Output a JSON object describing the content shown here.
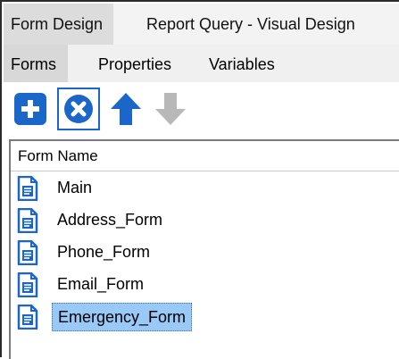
{
  "main_tabs": [
    {
      "label": "Form Design",
      "active": true
    },
    {
      "label": "Report Query - Visual Design",
      "active": false
    }
  ],
  "sub_tabs": [
    {
      "label": "Forms",
      "active": true
    },
    {
      "label": "Properties",
      "active": false
    },
    {
      "label": "Variables",
      "active": false
    }
  ],
  "toolbar": {
    "add_icon": "plus-icon",
    "remove_icon": "remove-circle-icon",
    "move_up_icon": "arrow-up-icon",
    "move_down_icon": "arrow-down-icon",
    "move_down_enabled": false
  },
  "list": {
    "header": "Form Name",
    "items": [
      {
        "label": "Main",
        "selected": false
      },
      {
        "label": "Address_Form",
        "selected": false
      },
      {
        "label": "Phone_Form",
        "selected": false
      },
      {
        "label": "Email_Form",
        "selected": false
      },
      {
        "label": "Emergency_Form",
        "selected": true
      }
    ]
  },
  "colors": {
    "accent_blue": "#1a66c9",
    "disabled_gray": "#b8b8b8",
    "selection_fill": "#99c9f7"
  }
}
